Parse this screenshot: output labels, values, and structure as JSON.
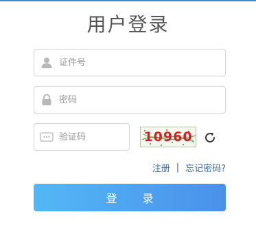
{
  "title": "用户登录",
  "fields": {
    "id_number": {
      "value": "",
      "placeholder": "证件号",
      "icon": "user-icon"
    },
    "password": {
      "value": "",
      "placeholder": "密码",
      "icon": "lock-icon"
    },
    "captcha": {
      "value": "",
      "placeholder": "验证码",
      "icon": "captcha-icon"
    }
  },
  "captcha_image": {
    "text": "10960"
  },
  "refresh_icon": "refresh-icon",
  "links": {
    "register": "注册",
    "separator": "|",
    "forgot_password": "忘记密码?"
  },
  "login_button": "登 录",
  "colors": {
    "accent_line": "#3b8fd9",
    "button_start": "#53b8f5",
    "button_end": "#4a90ea",
    "link": "#2f6fa8",
    "captcha_text": "#d62020"
  }
}
